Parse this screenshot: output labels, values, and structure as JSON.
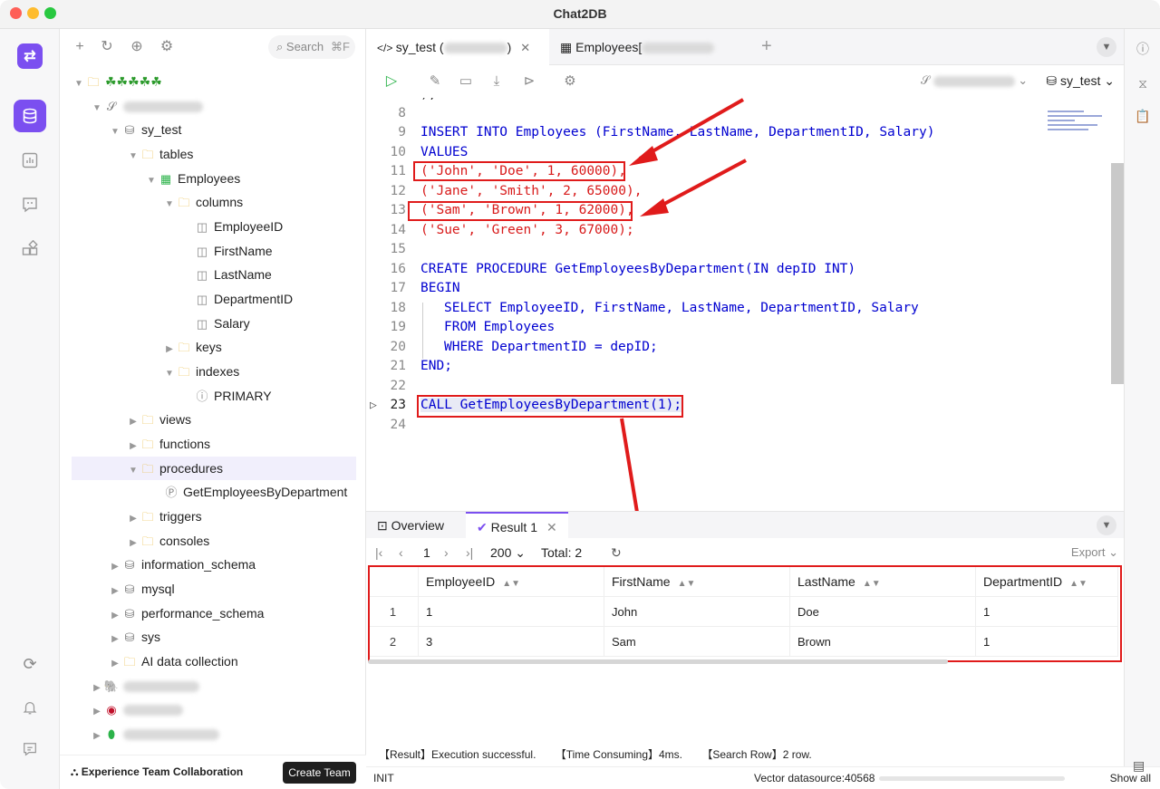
{
  "window": {
    "title": "Chat2DB"
  },
  "tree": {
    "search_placeholder": "Search",
    "search_shortcut": "⌘F",
    "root_label": "☘☘☘☘☘",
    "db_name": "sy_test",
    "tables_label": "tables",
    "table_name": "Employees",
    "columns_label": "columns",
    "columns": [
      "EmployeeID",
      "FirstName",
      "LastName",
      "DepartmentID",
      "Salary"
    ],
    "keys_label": "keys",
    "indexes_label": "indexes",
    "index_primary": "PRIMARY",
    "views_label": "views",
    "functions_label": "functions",
    "procedures_label": "procedures",
    "procedure_name": "GetEmployeesByDepartment",
    "triggers_label": "triggers",
    "consoles_label": "consoles",
    "other_dbs": [
      "information_schema",
      "mysql",
      "performance_schema",
      "sys",
      "AI data collection"
    ],
    "footer_label": "Experience Team Collaboration",
    "footer_button": "Create Team"
  },
  "tabs": {
    "tab1": "sy_test (",
    "tab1_suffix": ")",
    "tab2": "Employees["
  },
  "toolbar": {
    "db_selected": "sy_test"
  },
  "editor": {
    "lines": [
      "8",
      "9",
      "10",
      "11",
      "12",
      "13",
      "14",
      "15",
      "16",
      "17",
      "18",
      "19",
      "20",
      "21",
      "22",
      "23",
      "24"
    ],
    "code": {
      "l9": "INSERT INTO Employees (FirstName, LastName, DepartmentID, Salary)",
      "l10": "VALUES",
      "l11": "('John', 'Doe', 1, 60000),",
      "l12": "('Jane', 'Smith', 2, 65000),",
      "l13": "('Sam', 'Brown', 1, 62000),",
      "l14": "('Sue', 'Green', 3, 67000);",
      "l16": "CREATE PROCEDURE GetEmployeesByDepartment(IN depID INT)",
      "l17": "BEGIN",
      "l18": "SELECT EmployeeID, FirstName, LastName, DepartmentID, Salary",
      "l19": "FROM Employees",
      "l20": "WHERE DepartmentID = depID;",
      "l21": "END;",
      "l23": "CALL GetEmployeesByDepartment(1);"
    }
  },
  "results": {
    "tab_overview": "Overview",
    "tab_result": "Result 1",
    "page": "1",
    "page_size": "200",
    "total_label": "Total:",
    "total_value": "2",
    "export_label": "Export",
    "columns": [
      "EmployeeID",
      "FirstName",
      "LastName",
      "DepartmentID"
    ],
    "rows": [
      {
        "num": "1",
        "EmployeeID": "1",
        "FirstName": "John",
        "LastName": "Doe",
        "DepartmentID": "1"
      },
      {
        "num": "2",
        "EmployeeID": "3",
        "FirstName": "Sam",
        "LastName": "Brown",
        "DepartmentID": "1"
      }
    ]
  },
  "status": {
    "result": "【Result】Execution successful.",
    "time": "【Time Consuming】4ms.",
    "search_row": "【Search Row】2 row.",
    "init": "INIT",
    "vector": "Vector datasource:40568",
    "show_all": "Show all"
  },
  "colors": {
    "accent": "#7b4ff0",
    "annotation_red": "#e01b1b",
    "run_green": "#2cb34a"
  }
}
